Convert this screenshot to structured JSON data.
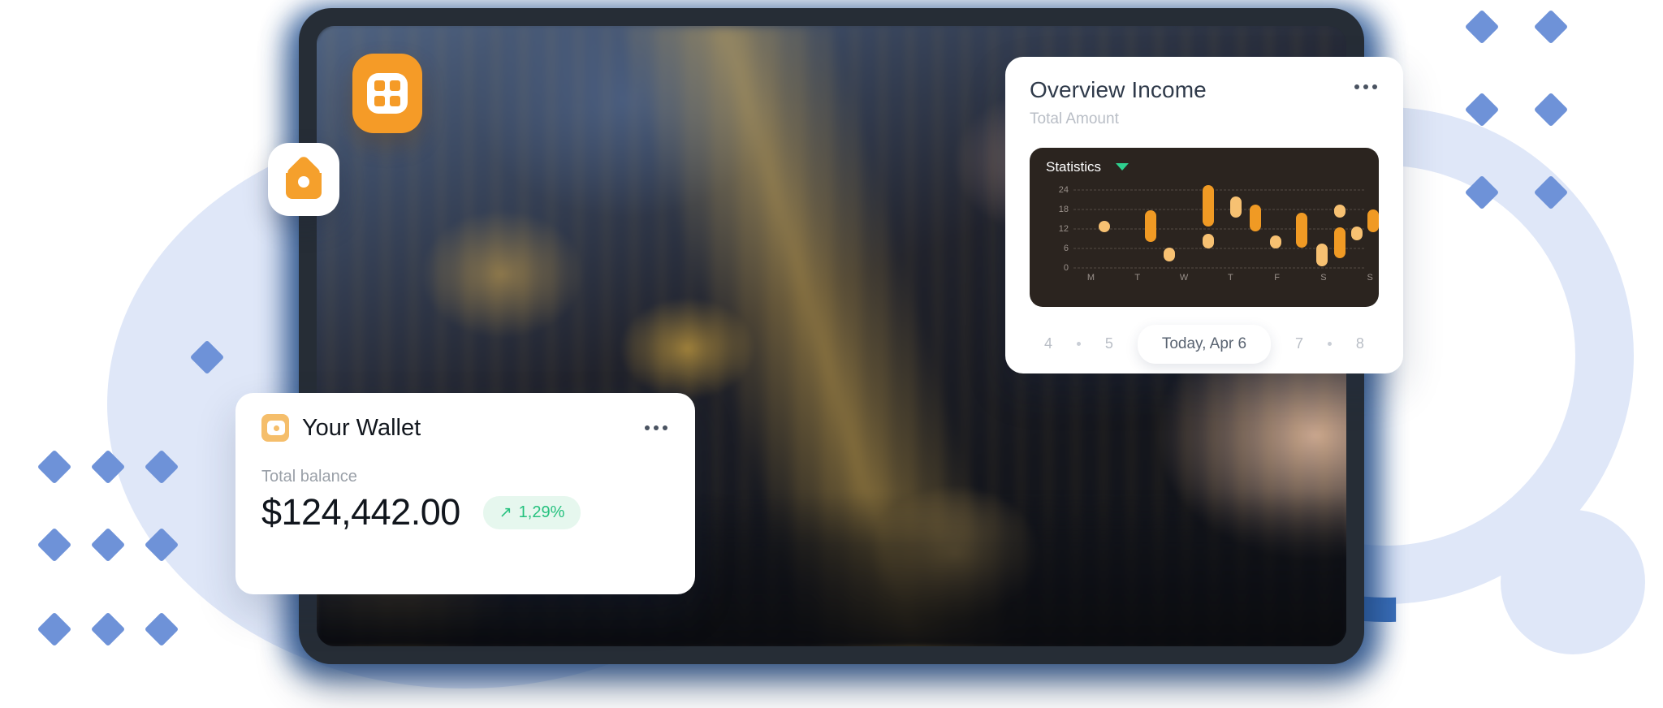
{
  "overview_card": {
    "title": "Overview Income",
    "subtitle": "Total Amount",
    "menu_icon": "ellipsis-icon",
    "panel": {
      "title": "Statistics",
      "dropdown_icon": "caret-down-icon",
      "accent_color": "#2ecf8e",
      "background": "#2b241f"
    },
    "pager": {
      "prev_pages": [
        "4",
        "5"
      ],
      "next_pages": [
        "7",
        "8"
      ],
      "current_label": "Today, Apr 6",
      "dot": "•"
    }
  },
  "wallet_card": {
    "icon": "wallet-icon",
    "title": "Your Wallet",
    "menu_icon": "ellipsis-icon",
    "balance_label": "Total balance",
    "balance_value": "$124,442.00",
    "change_arrow": "↗",
    "change_value": "1,29%",
    "change_color": "#25c17e",
    "change_bg": "#e6f7ee"
  },
  "floating_icons": [
    {
      "name": "grid-apps-icon",
      "color": "#F59B27"
    },
    {
      "name": "home-icon",
      "color": "#F5A02C"
    }
  ],
  "device": {
    "name": "tablet-device",
    "bezel_color": "#262d36",
    "screen_content": "blurred-candlestick-trading-photo"
  },
  "decor": {
    "ellipse_color": "#dfe7f8",
    "ring_color": "#dfe7f8",
    "ring_accent_color": "#2f66b5",
    "diamond_color": "#6e92d8"
  },
  "chart_data": {
    "type": "bar",
    "title": "Statistics",
    "xlabel": "",
    "ylabel": "",
    "ylim": [
      0,
      26
    ],
    "yticks": [
      0,
      6,
      12,
      18,
      24
    ],
    "grid": true,
    "legend": false,
    "categories": [
      "M",
      "T",
      "W",
      "T",
      "F",
      "S",
      "S"
    ],
    "colors": {
      "light": "#F7C172",
      "dark": "#F09A24"
    },
    "bars": [
      {
        "day": "M",
        "slot": 0,
        "low": 11.0,
        "high": 14.5,
        "shade": "light"
      },
      {
        "day": "T",
        "slot": 0,
        "low": 8.0,
        "high": 17.8,
        "shade": "dark"
      },
      {
        "day": "T",
        "slot": 1,
        "low": 2.0,
        "high": 6.3,
        "shade": "light"
      },
      {
        "day": "W",
        "slot": 0,
        "low": 12.8,
        "high": 25.5,
        "shade": "dark"
      },
      {
        "day": "W",
        "slot": 1,
        "low": 6.0,
        "high": 10.5,
        "shade": "light"
      },
      {
        "day": "W",
        "slot": 2,
        "low": 15.5,
        "high": 22.0,
        "shade": "light"
      },
      {
        "day": "T",
        "slot": 2,
        "low": 11.2,
        "high": 19.5,
        "shade": "dark"
      },
      {
        "day": "T",
        "slot": 3,
        "low": 6.0,
        "high": 10.0,
        "shade": "light"
      },
      {
        "day": "F",
        "slot": 0,
        "low": 6.3,
        "high": 17.0,
        "shade": "dark"
      },
      {
        "day": "F",
        "slot": 1,
        "low": 0.5,
        "high": 7.5,
        "shade": "light"
      },
      {
        "day": "S",
        "slot": 0,
        "low": 15.5,
        "high": 19.5,
        "shade": "light"
      },
      {
        "day": "S",
        "slot": 1,
        "low": 3.0,
        "high": 12.5,
        "shade": "dark"
      },
      {
        "day": "S",
        "slot": 2,
        "low": 8.5,
        "high": 12.8,
        "shade": "light"
      },
      {
        "day": "S",
        "slot": 3,
        "low": 11.0,
        "high": 18.0,
        "shade": "dark"
      }
    ],
    "bar_x_percent": [
      10.5,
      26.5,
      33.0,
      46.5,
      46.5,
      56.0,
      62.5,
      69.5,
      78.5,
      85.5,
      91.5,
      91.5,
      97.5,
      103.0
    ]
  }
}
